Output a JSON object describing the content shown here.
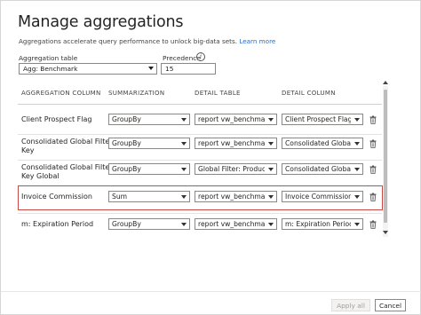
{
  "dialog": {
    "title": "Manage aggregations",
    "description": "Aggregations accelerate query performance to unlock big-data sets.",
    "learn_more": "Learn more"
  },
  "aggregation_table": {
    "label": "Aggregation table",
    "value": "Agg: Benchmark"
  },
  "precedence": {
    "label": "Precedence",
    "value": "15",
    "info_icon": "info-icon"
  },
  "columns": {
    "aggregation_column": "AGGREGATION COLUMN",
    "summarization": "SUMMARIZATION",
    "detail_table": "DETAIL TABLE",
    "detail_column": "DETAIL COLUMN"
  },
  "rows": [
    {
      "label_lines": [
        "Client Prospect Flag",
        ""
      ],
      "summarization": "GroupBy",
      "detail_table": "report vw_benchmar...",
      "detail_column": "Client Prospect Flag"
    },
    {
      "label_lines": [
        "Consolidated Global Filter",
        "Key"
      ],
      "summarization": "GroupBy",
      "detail_table": "report vw_benchmar...",
      "detail_column": "Consolidated Global..."
    },
    {
      "label_lines": [
        "Consolidated Global Filter",
        "Key Global"
      ],
      "summarization": "GroupBy",
      "detail_table": "Global Filter: Produc...",
      "detail_column": "Consolidated Global..."
    },
    {
      "label_lines": [
        "Invoice Commission",
        ""
      ],
      "summarization": "Sum",
      "detail_table": "report vw_benchmar...",
      "detail_column": "Invoice Commission"
    },
    {
      "label_lines": [
        "m: Expiration Period",
        ""
      ],
      "summarization": "GroupBy",
      "detail_table": "report vw_benchmar...",
      "detail_column": "m: Expiration Period"
    }
  ],
  "footer": {
    "apply_all": "Apply all",
    "cancel": "Cancel"
  },
  "colors": {
    "highlight": "#c84a44",
    "link": "#2b6cc4"
  }
}
